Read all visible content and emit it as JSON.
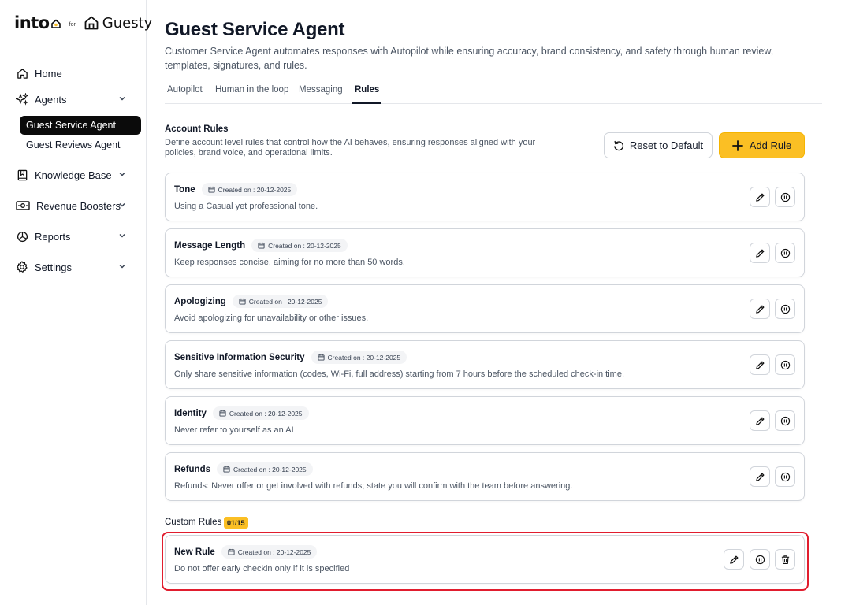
{
  "brand": {
    "logo_left": "into",
    "for": "for",
    "logo_right": "Guesty",
    "accent": "#fbbf24"
  },
  "sidebar": {
    "items": [
      {
        "label": "Home",
        "icon": "home-icon"
      },
      {
        "label": "Agents",
        "icon": "sparkle-icon",
        "expandable": true
      },
      {
        "label": "Knowledge Base",
        "icon": "book-icon",
        "expandable": true
      },
      {
        "label": "Revenue Boosters",
        "icon": "money-icon",
        "expandable": true
      },
      {
        "label": "Reports",
        "icon": "pie-chart-icon",
        "expandable": true
      },
      {
        "label": "Settings",
        "icon": "gear-icon",
        "expandable": true
      }
    ],
    "agents_sub": [
      {
        "label": "Guest Service Agent",
        "active": true
      },
      {
        "label": "Guest Reviews Agent",
        "active": false
      }
    ]
  },
  "page": {
    "title": "Guest Service Agent",
    "description": "Customer Service Agent automates responses with Autopilot while ensuring accuracy, brand consistency, and safety through human review, templates, signatures, and rules."
  },
  "tabs": [
    {
      "label": "Autopilot",
      "active": false
    },
    {
      "label": "Human in the loop",
      "active": false
    },
    {
      "label": "Messaging",
      "active": false
    },
    {
      "label": "Rules",
      "active": true
    }
  ],
  "account_rules": {
    "title": "Account Rules",
    "description": "Define account level rules that control how the AI behaves, ensuring responses aligned with your policies, brand voice, and operational limits.",
    "reset_label": "Reset to Default",
    "add_label": "Add Rule",
    "rules": [
      {
        "name": "Tone",
        "created": "Created on : 20-12-2025",
        "text": "Using a Casual yet professional tone."
      },
      {
        "name": "Message Length",
        "created": "Created on : 20-12-2025",
        "text": "Keep responses concise, aiming for no more than 50 words."
      },
      {
        "name": "Apologizing",
        "created": "Created on : 20-12-2025",
        "text": "Avoid apologizing for unavailability or other issues."
      },
      {
        "name": "Sensitive Information Security",
        "created": "Created on : 20-12-2025",
        "text": "Only share sensitive information (codes, Wi-Fi, full address) starting from 7 hours before the scheduled check-in time."
      },
      {
        "name": "Identity",
        "created": "Created on : 20-12-2025",
        "text": "Never refer to yourself as an AI"
      },
      {
        "name": "Refunds",
        "created": "Created on : 20-12-2025",
        "text": "Refunds: Never offer or get involved with refunds; state you will confirm with the team before answering."
      }
    ]
  },
  "custom_rules": {
    "title": "Custom Rules",
    "count": "01/15",
    "highlight_color": "#e11d2e",
    "rules": [
      {
        "name": "New Rule",
        "created": "Created on : 20-12-2025",
        "text": "Do not offer early checkin only if it is specified"
      }
    ]
  }
}
